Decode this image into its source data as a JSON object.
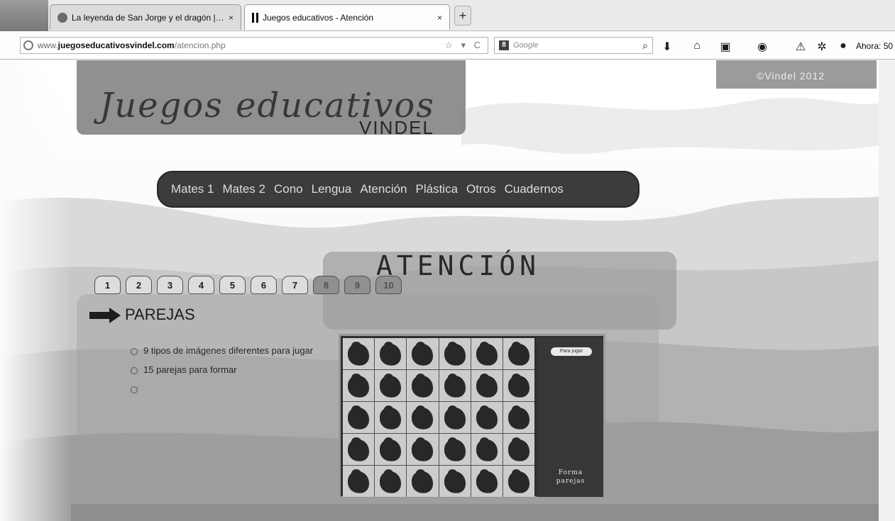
{
  "browser": {
    "tabs": [
      {
        "title": "La leyenda de San Jorge y el dragón | ...",
        "close": "×"
      },
      {
        "title": "Juegos educativos - Atención",
        "close": "×"
      }
    ],
    "new_tab": "+",
    "address": {
      "host_prefix": "www.",
      "host_bold": "juegoseducativosvindel.com",
      "path": "/atencion.php",
      "controls": "☆ ▾ C"
    },
    "search": {
      "engine": "8",
      "placeholder": "Google",
      "icon": "search-icon"
    },
    "ahora_text": "Ahora: 50",
    "toolbar_icons": [
      "download-icon",
      "home-icon",
      "bookmark-icon",
      "pocket-icon",
      "warning-icon",
      "puzzle-icon",
      "globe-icon"
    ]
  },
  "site": {
    "logo_title": "Juegos educativos",
    "logo_subtitle": "VINDEL",
    "copyright": "©Vindel 2012",
    "menu": [
      "Mates 1",
      "Mates 2",
      "Cono",
      "Lengua",
      "Atención",
      "Plástica",
      "Otros",
      "Cuadernos"
    ],
    "section_title": "ATENCIÓN",
    "page_tabs": [
      "1",
      "2",
      "3",
      "4",
      "5",
      "6",
      "7",
      "8",
      "9",
      "10"
    ],
    "active_tabs_count": 7
  },
  "game": {
    "title": "PAREJAS",
    "features": [
      "9 tipos de imágenes diferentes para jugar",
      "15 parejas para formar",
      ""
    ],
    "button_label": "Para jugar",
    "caption": "Forma parejas",
    "grid": {
      "rows": 5,
      "cols": 6
    }
  },
  "colors": {
    "page_bg": "#efefef",
    "menu_bg": "#3f3f3f",
    "game_bg": "#333333"
  }
}
